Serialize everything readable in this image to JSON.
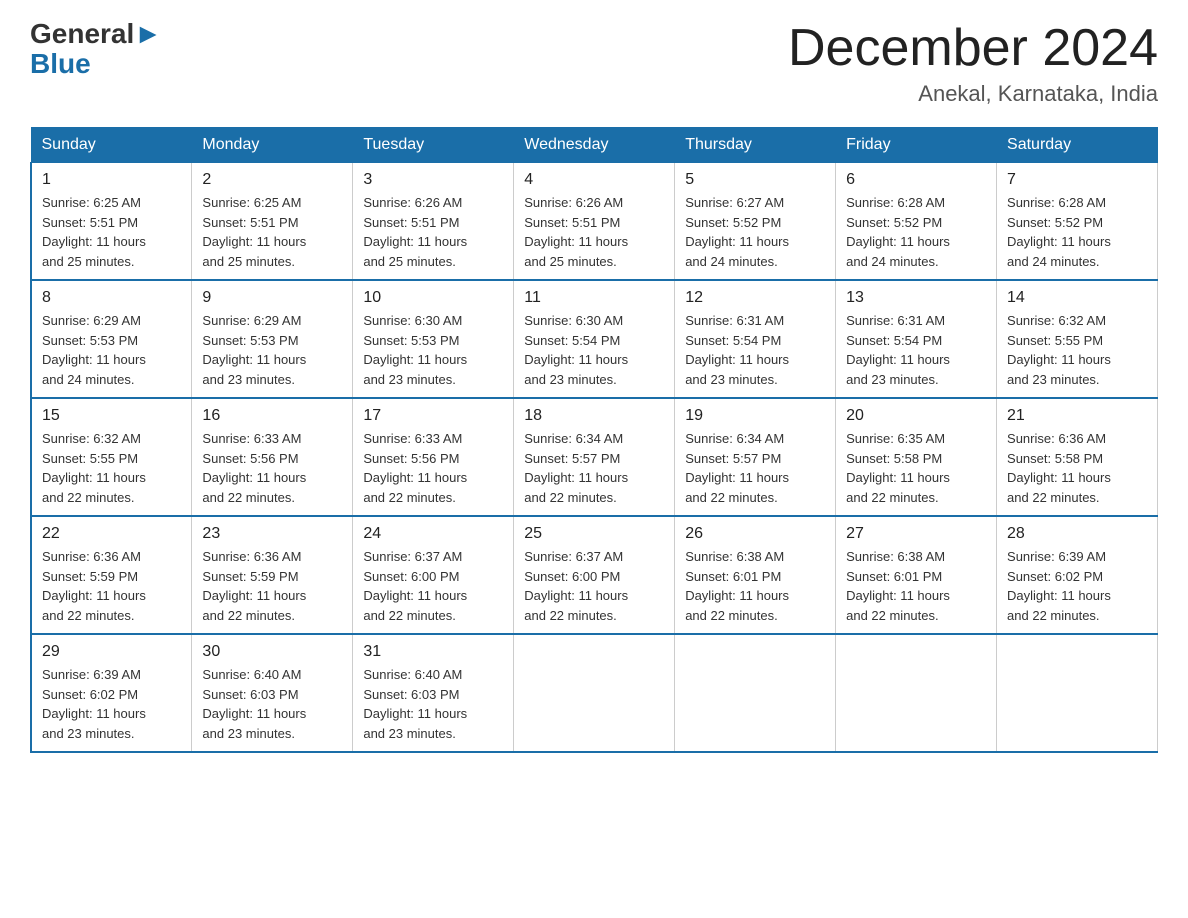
{
  "header": {
    "logo_general": "General",
    "logo_blue": "Blue",
    "month_year": "December 2024",
    "location": "Anekal, Karnataka, India"
  },
  "weekdays": [
    "Sunday",
    "Monday",
    "Tuesday",
    "Wednesday",
    "Thursday",
    "Friday",
    "Saturday"
  ],
  "weeks": [
    [
      {
        "day": "1",
        "sunrise": "6:25 AM",
        "sunset": "5:51 PM",
        "daylight": "11 hours and 25 minutes."
      },
      {
        "day": "2",
        "sunrise": "6:25 AM",
        "sunset": "5:51 PM",
        "daylight": "11 hours and 25 minutes."
      },
      {
        "day": "3",
        "sunrise": "6:26 AM",
        "sunset": "5:51 PM",
        "daylight": "11 hours and 25 minutes."
      },
      {
        "day": "4",
        "sunrise": "6:26 AM",
        "sunset": "5:51 PM",
        "daylight": "11 hours and 25 minutes."
      },
      {
        "day": "5",
        "sunrise": "6:27 AM",
        "sunset": "5:52 PM",
        "daylight": "11 hours and 24 minutes."
      },
      {
        "day": "6",
        "sunrise": "6:28 AM",
        "sunset": "5:52 PM",
        "daylight": "11 hours and 24 minutes."
      },
      {
        "day": "7",
        "sunrise": "6:28 AM",
        "sunset": "5:52 PM",
        "daylight": "11 hours and 24 minutes."
      }
    ],
    [
      {
        "day": "8",
        "sunrise": "6:29 AM",
        "sunset": "5:53 PM",
        "daylight": "11 hours and 24 minutes."
      },
      {
        "day": "9",
        "sunrise": "6:29 AM",
        "sunset": "5:53 PM",
        "daylight": "11 hours and 23 minutes."
      },
      {
        "day": "10",
        "sunrise": "6:30 AM",
        "sunset": "5:53 PM",
        "daylight": "11 hours and 23 minutes."
      },
      {
        "day": "11",
        "sunrise": "6:30 AM",
        "sunset": "5:54 PM",
        "daylight": "11 hours and 23 minutes."
      },
      {
        "day": "12",
        "sunrise": "6:31 AM",
        "sunset": "5:54 PM",
        "daylight": "11 hours and 23 minutes."
      },
      {
        "day": "13",
        "sunrise": "6:31 AM",
        "sunset": "5:54 PM",
        "daylight": "11 hours and 23 minutes."
      },
      {
        "day": "14",
        "sunrise": "6:32 AM",
        "sunset": "5:55 PM",
        "daylight": "11 hours and 23 minutes."
      }
    ],
    [
      {
        "day": "15",
        "sunrise": "6:32 AM",
        "sunset": "5:55 PM",
        "daylight": "11 hours and 22 minutes."
      },
      {
        "day": "16",
        "sunrise": "6:33 AM",
        "sunset": "5:56 PM",
        "daylight": "11 hours and 22 minutes."
      },
      {
        "day": "17",
        "sunrise": "6:33 AM",
        "sunset": "5:56 PM",
        "daylight": "11 hours and 22 minutes."
      },
      {
        "day": "18",
        "sunrise": "6:34 AM",
        "sunset": "5:57 PM",
        "daylight": "11 hours and 22 minutes."
      },
      {
        "day": "19",
        "sunrise": "6:34 AM",
        "sunset": "5:57 PM",
        "daylight": "11 hours and 22 minutes."
      },
      {
        "day": "20",
        "sunrise": "6:35 AM",
        "sunset": "5:58 PM",
        "daylight": "11 hours and 22 minutes."
      },
      {
        "day": "21",
        "sunrise": "6:36 AM",
        "sunset": "5:58 PM",
        "daylight": "11 hours and 22 minutes."
      }
    ],
    [
      {
        "day": "22",
        "sunrise": "6:36 AM",
        "sunset": "5:59 PM",
        "daylight": "11 hours and 22 minutes."
      },
      {
        "day": "23",
        "sunrise": "6:36 AM",
        "sunset": "5:59 PM",
        "daylight": "11 hours and 22 minutes."
      },
      {
        "day": "24",
        "sunrise": "6:37 AM",
        "sunset": "6:00 PM",
        "daylight": "11 hours and 22 minutes."
      },
      {
        "day": "25",
        "sunrise": "6:37 AM",
        "sunset": "6:00 PM",
        "daylight": "11 hours and 22 minutes."
      },
      {
        "day": "26",
        "sunrise": "6:38 AM",
        "sunset": "6:01 PM",
        "daylight": "11 hours and 22 minutes."
      },
      {
        "day": "27",
        "sunrise": "6:38 AM",
        "sunset": "6:01 PM",
        "daylight": "11 hours and 22 minutes."
      },
      {
        "day": "28",
        "sunrise": "6:39 AM",
        "sunset": "6:02 PM",
        "daylight": "11 hours and 22 minutes."
      }
    ],
    [
      {
        "day": "29",
        "sunrise": "6:39 AM",
        "sunset": "6:02 PM",
        "daylight": "11 hours and 23 minutes."
      },
      {
        "day": "30",
        "sunrise": "6:40 AM",
        "sunset": "6:03 PM",
        "daylight": "11 hours and 23 minutes."
      },
      {
        "day": "31",
        "sunrise": "6:40 AM",
        "sunset": "6:03 PM",
        "daylight": "11 hours and 23 minutes."
      },
      null,
      null,
      null,
      null
    ]
  ],
  "labels": {
    "sunrise": "Sunrise:",
    "sunset": "Sunset:",
    "daylight": "Daylight:"
  }
}
